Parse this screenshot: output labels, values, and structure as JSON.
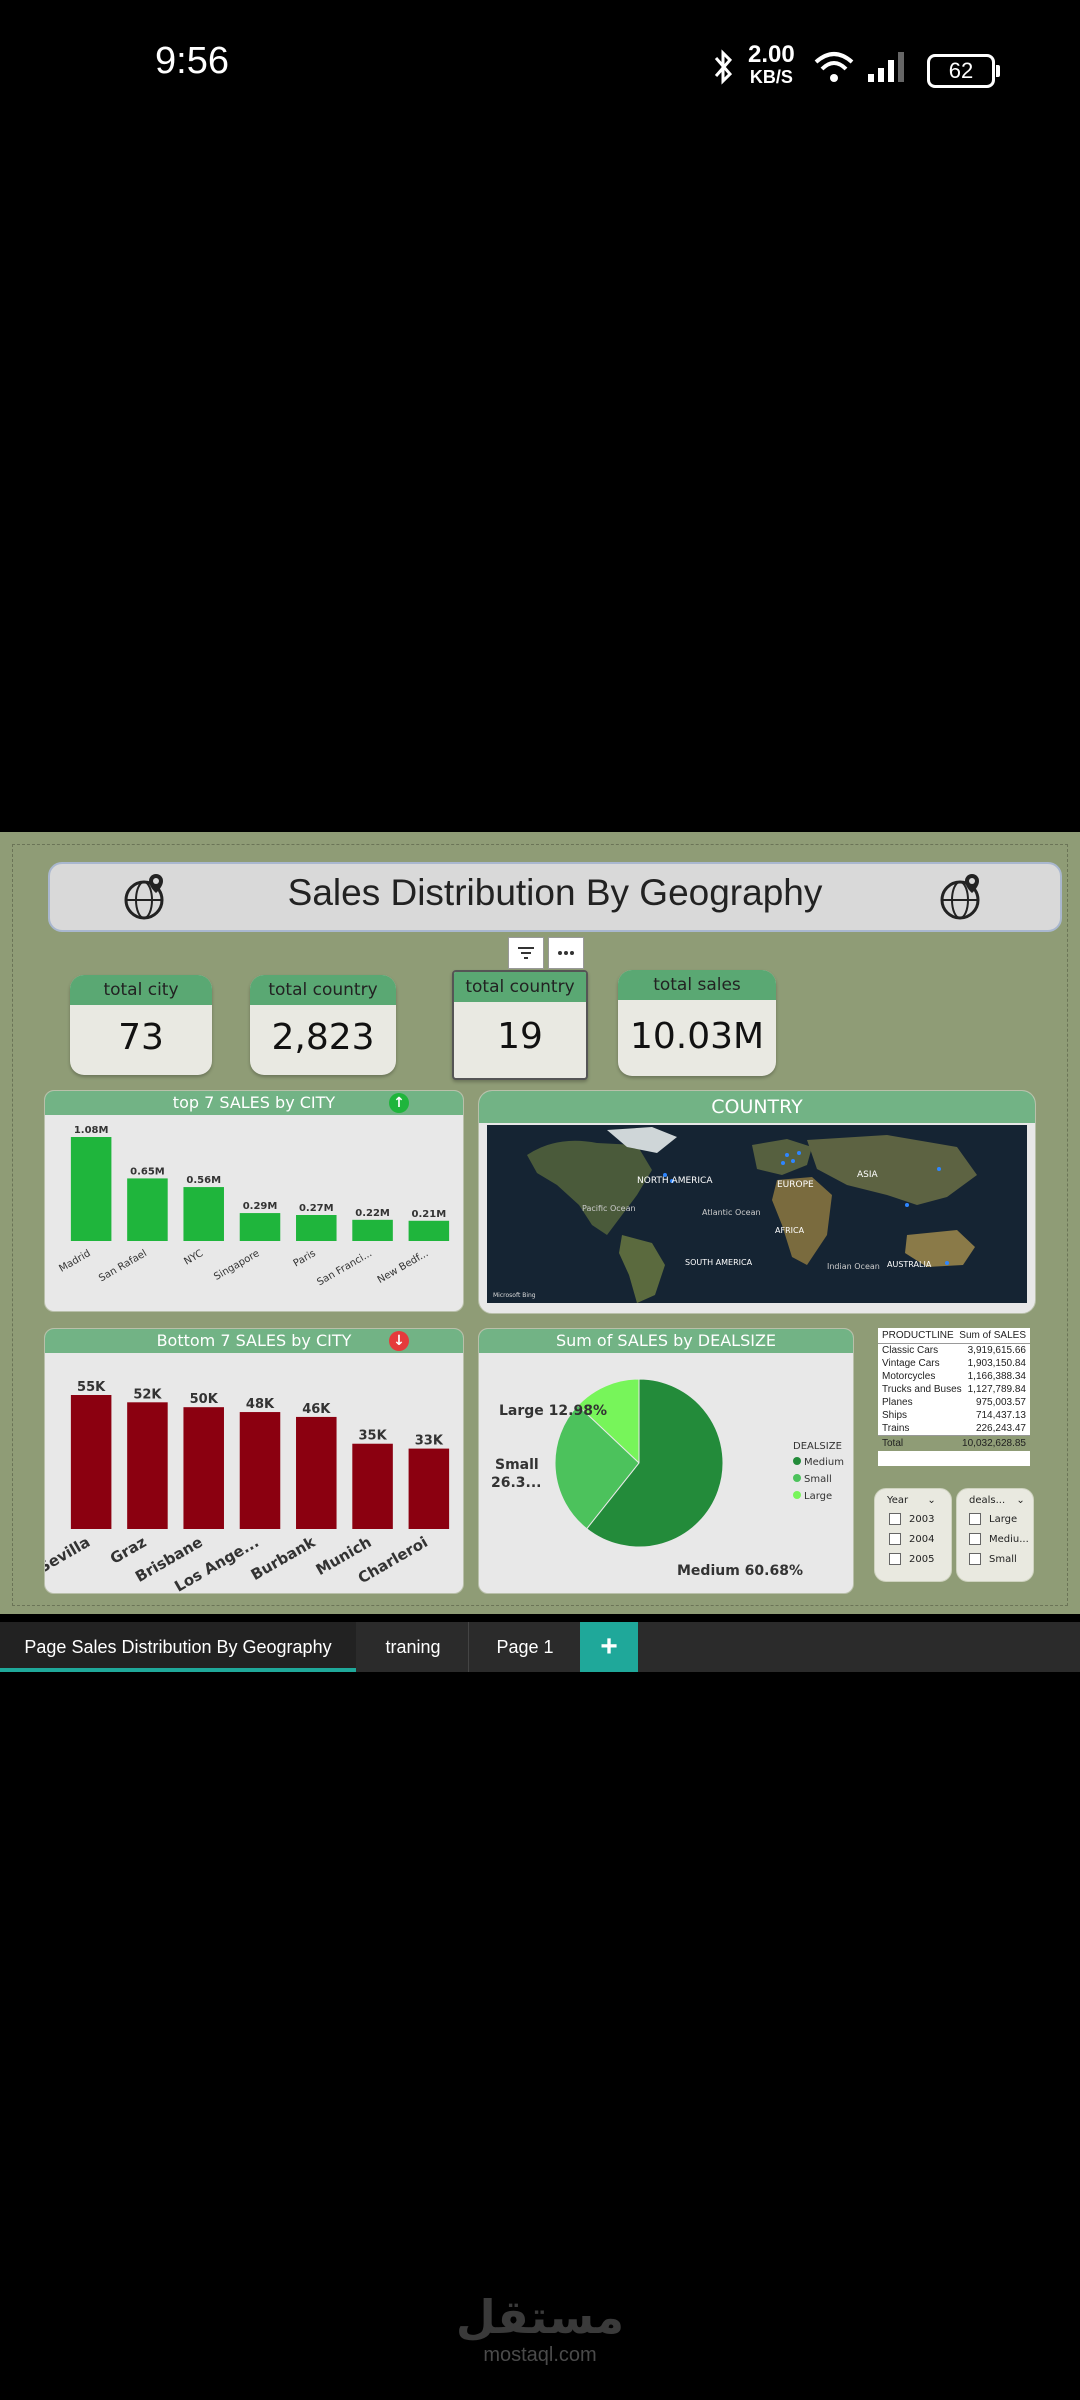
{
  "status_bar": {
    "time": "9:56",
    "net_speed": "2.00",
    "net_unit": "KB/S",
    "battery": "62"
  },
  "dashboard": {
    "title": "Sales Distribution By Geography",
    "kpis": [
      {
        "label": "total city",
        "value": "73"
      },
      {
        "label": "total country",
        "value": "2,823"
      },
      {
        "label": "total country",
        "value": "19"
      },
      {
        "label": "total sales",
        "value": "10.03M"
      }
    ],
    "top_chart_title": "top 7 SALES by CITY",
    "map_title": "COUNTRY",
    "map_labels": {
      "north_america": "NORTH AMERICA",
      "europe": "EUROPE",
      "asia": "ASIA",
      "pacific": "Pacific Ocean",
      "atlantic": "Atlantic Ocean",
      "africa": "AFRICA",
      "south_america": "SOUTH AMERICA",
      "indian": "Indian Ocean",
      "australia": "AUSTRALIA",
      "brand": "Microsoft Bing"
    },
    "bottom_chart_title": "Bottom 7 SALES by CITY",
    "pie_title": "Sum of SALES by DEALSIZE",
    "pie_legend_title": "DEALSIZE",
    "pie_labels": {
      "large": "Large 12.98%",
      "small_1": "Small",
      "small_2": "26.3...",
      "medium": "Medium 60.68%"
    },
    "table": {
      "headers": [
        "PRODUCTLINE",
        "Sum of SALES"
      ],
      "rows": [
        [
          "Classic Cars",
          "3,919,615.66"
        ],
        [
          "Vintage Cars",
          "1,903,150.84"
        ],
        [
          "Motorcycles",
          "1,166,388.34"
        ],
        [
          "Trucks and Buses",
          "1,127,789.84"
        ],
        [
          "Planes",
          "975,003.57"
        ],
        [
          "Ships",
          "714,437.13"
        ],
        [
          "Trains",
          "226,243.47"
        ]
      ],
      "total_label": "Total",
      "total_value": "10,032,628.85"
    },
    "year_slicer": {
      "title": "Year",
      "options": [
        "2003",
        "2004",
        "2005"
      ]
    },
    "deal_slicer": {
      "title": "deals...",
      "options": [
        "Large",
        "Mediu...",
        "Small"
      ]
    }
  },
  "chart_data": [
    {
      "type": "bar",
      "title": "top 7 SALES by CITY",
      "categories": [
        "Madrid",
        "San Rafael",
        "NYC",
        "Singapore",
        "Paris",
        "San Franci...",
        "New Bedf..."
      ],
      "values": [
        1.08,
        0.65,
        0.56,
        0.29,
        0.27,
        0.22,
        0.21
      ],
      "data_labels": [
        "1.08M",
        "0.65M",
        "0.56M",
        "0.29M",
        "0.27M",
        "0.22M",
        "0.21M"
      ],
      "color": "#1fb53c"
    },
    {
      "type": "bar",
      "title": "Bottom 7 SALES by CITY",
      "categories": [
        "Sevilla",
        "Graz",
        "Brisbane",
        "Los Ange...",
        "Burbank",
        "Munich",
        "Charleroi"
      ],
      "values": [
        55,
        52,
        50,
        48,
        46,
        35,
        33
      ],
      "data_labels": [
        "55K",
        "52K",
        "50K",
        "48K",
        "46K",
        "35K",
        "33K"
      ],
      "color": "#8b0010"
    },
    {
      "type": "pie",
      "title": "Sum of SALES by DEALSIZE",
      "categories": [
        "Medium",
        "Small",
        "Large"
      ],
      "values": [
        60.68,
        26.34,
        12.98
      ],
      "colors": [
        "#238b3a",
        "#4cc25c",
        "#77f55a"
      ]
    }
  ],
  "tabs": [
    {
      "label": "Page Sales Distribution By Geography",
      "active": true
    },
    {
      "label": "traning",
      "active": false
    },
    {
      "label": "Page 1",
      "active": false
    }
  ],
  "add_tab": "+",
  "watermark": {
    "arabic": "مستقل",
    "latin": "mostaql.com"
  }
}
